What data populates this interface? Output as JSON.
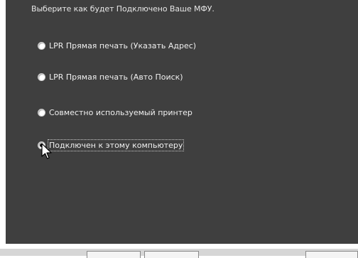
{
  "dialog": {
    "prompt": "Выберите как будет Подключено Ваше МФУ."
  },
  "options": [
    {
      "label": "LPR Прямая печать (Указать Адрес)",
      "selected": false
    },
    {
      "label": "LPR Прямая печать (Авто Поиск)",
      "selected": false
    },
    {
      "label": "Совместно используемый принтер",
      "selected": false
    },
    {
      "label": "Подключен к этому компьютеру",
      "selected": true
    }
  ],
  "colors": {
    "panel_background": "#3f3f3f",
    "text": "#f0f0f0"
  }
}
